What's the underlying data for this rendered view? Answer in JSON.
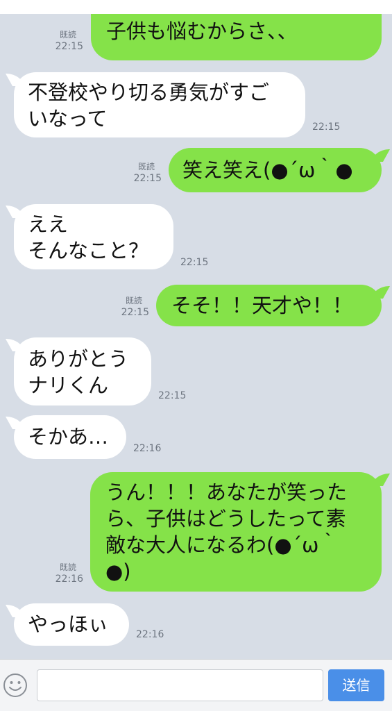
{
  "colors": {
    "background": "#d7dde6",
    "incoming_bubble": "#ffffff",
    "outgoing_bubble": "#85e249",
    "send_button": "#4a8fe8"
  },
  "messages": [
    {
      "side": "out",
      "text": "お母さんが深刻になると、\n子供も悩むからさ、、",
      "read": "既読",
      "time": "22:15"
    },
    {
      "side": "in",
      "text": "不登校やり切る勇気がすご\nいなって",
      "time": "22:15"
    },
    {
      "side": "out",
      "text": "笑え笑え(●´ω｀●",
      "read": "既読",
      "time": "22:15"
    },
    {
      "side": "in",
      "text": "ええ\nそんなこと？",
      "time": "22:15"
    },
    {
      "side": "out",
      "text": "そそ！！天才や！！",
      "read": "既読",
      "time": "22:15"
    },
    {
      "side": "in",
      "text": "ありがとう\nナリくん",
      "time": "22:15"
    },
    {
      "side": "in",
      "text": "そかあ…",
      "time": "22:16"
    },
    {
      "side": "out",
      "text": "うん！！！あなたが笑った\nら、子供はどうしたって素\n敵な大人になるわ(●´ω｀\n●)",
      "read": "既読",
      "time": "22:16"
    },
    {
      "side": "in",
      "text": "やっほぃ",
      "time": "22:16"
    }
  ],
  "input": {
    "value": "",
    "placeholder": ""
  },
  "send_label": "送信",
  "emoji_icon": "smiley-icon"
}
